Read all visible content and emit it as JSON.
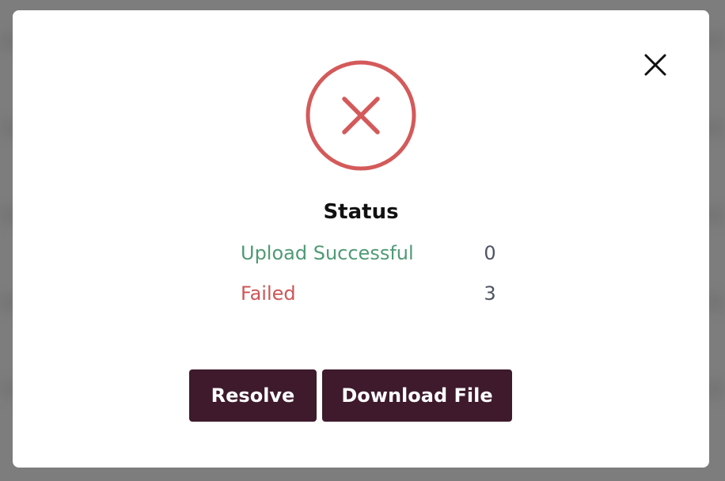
{
  "dialog": {
    "title": "Status",
    "status_icon": "error-circle-x-icon",
    "close_icon": "close-icon",
    "colors": {
      "error": "#d45a5a",
      "success": "#4f9a75",
      "button_bg": "#3e1a2c",
      "button_text": "#ffffff"
    },
    "rows": [
      {
        "label": "Upload Successful",
        "value": "0"
      },
      {
        "label": "Failed",
        "value": "3"
      }
    ],
    "buttons": {
      "resolve_label": "Resolve",
      "download_label": "Download File"
    }
  }
}
